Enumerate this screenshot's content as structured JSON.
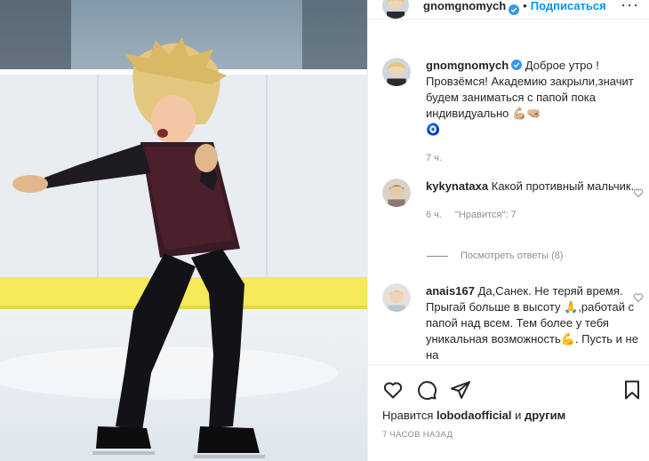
{
  "post": {
    "author": "gnomgnomych",
    "dot": "•",
    "follow_label": "Подписаться",
    "more_label": "···",
    "caption": "Доброе утро ! Провзёмся! Академию закрыли,значит будем заниматься с папой пока индивидуально 💪🏼🤜🏼",
    "caption_emoji": "🧿",
    "caption_time": "7 ч."
  },
  "comments": [
    {
      "user": "kykynataxa",
      "text": "Какой противный мальчик.",
      "time": "6 ч.",
      "likes": "\"Нравится\": 7"
    },
    {
      "user": "anais167",
      "text_part1": "Да,Санек. Не теряй время. Прыгай больше в высоту ",
      "emoji1": "🙏",
      "text_part2": ",работай с папой над всем. Тем более у тебя уникальная возможность",
      "emoji2": "💪",
      "text_part3": ". Пусть и не на"
    }
  ],
  "view_replies": "Посмотреть ответы (8)",
  "likes": {
    "prefix": "Нравится",
    "user": "lobodaofficial",
    "middle": "и",
    "suffix": "другим"
  },
  "timestamp": "7 ЧАСОВ НАЗАД",
  "icons": [
    "heart-icon",
    "comment-icon",
    "share-icon",
    "bookmark-icon",
    "verified-icon"
  ],
  "colors": {
    "accent": "#0095f6",
    "verified": "#3897f0",
    "muted": "#8e8e8e",
    "text": "#262626",
    "rink_yellow": "#f4ea5a"
  }
}
